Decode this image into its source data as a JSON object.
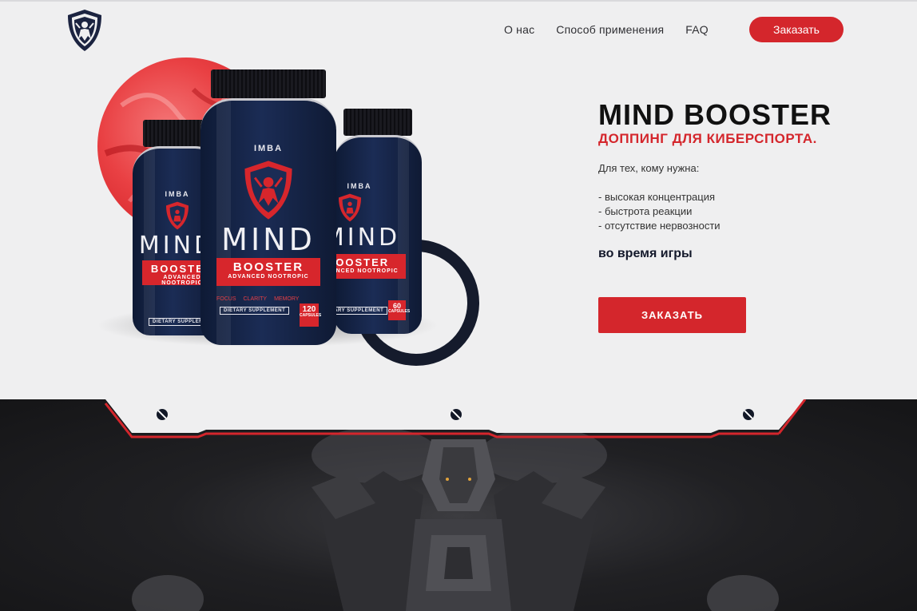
{
  "header": {
    "logo_icon": "shield-warrior-logo",
    "nav": [
      {
        "label": "О нас"
      },
      {
        "label": "Способ применения"
      },
      {
        "label": "FAQ"
      }
    ],
    "order_button": "Заказать"
  },
  "product": {
    "bottles": [
      {
        "brand": "IMBA",
        "name": "MIND",
        "booster": "BOOSTER",
        "tagline": "ADVANCED NOOTROPIC",
        "icons": [
          "FOCUS",
          "CLARITY",
          "MEMORY"
        ],
        "supplement": "DIETARY SUPPLEMENT",
        "count": "120",
        "count_unit": "CAPSULES"
      },
      {
        "brand": "IMBA",
        "name": "MIND",
        "booster": "BOOSTER",
        "tagline": "ADVANCED NOOTROPIC",
        "supplement": "DIETARY SUPPLEMENT"
      },
      {
        "brand": "IMBA",
        "name": "MIND",
        "booster": "BOOSTER",
        "tagline": "ADVANCED NOOTROPIC",
        "supplement": "DIETARY SUPPLEMENT",
        "count": "60",
        "count_unit": "CAPSULES"
      }
    ]
  },
  "hero": {
    "title": "MIND BOOSTER",
    "subtitle": "ДОППИНГ ДЛЯ КИБЕРСПОРТА.",
    "intro": "Для тех, кому нужна:",
    "benefits": [
      "- высокая концентрация",
      "- быстрота реакции",
      "- отсутствие нервозности"
    ],
    "during": "во время игры",
    "cta": "ЗАКАЗАТЬ"
  },
  "colors": {
    "accent": "#d4262c",
    "navy": "#151b2c",
    "background": "#efeff0"
  }
}
